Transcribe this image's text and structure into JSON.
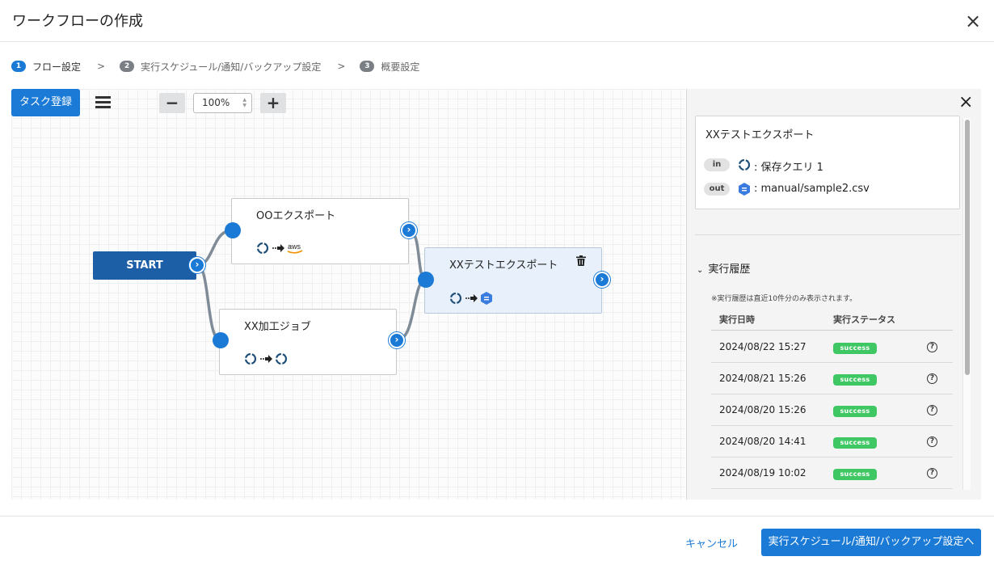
{
  "modal": {
    "title": "ワークフローの作成",
    "close_icon": "×"
  },
  "steps": [
    {
      "num": "1",
      "label": "フロー設定"
    },
    {
      "num": "2",
      "label": "実行スケジュール/通知/バックアップ設定"
    },
    {
      "num": "3",
      "label": "概要設定"
    }
  ],
  "step_separator": ">",
  "toolbar": {
    "task_button": "タスク登録",
    "zoom_minus": "−",
    "zoom_value": "100%",
    "zoom_plus": "+"
  },
  "flow": {
    "start_label": "START",
    "nodes": [
      {
        "label": "OOエクスポート"
      },
      {
        "label": "XX加工ジョブ"
      },
      {
        "label": "XXテストエクスポート"
      }
    ],
    "aws_label": "aws"
  },
  "panel": {
    "card_title": "XXテストエクスポート",
    "in_badge": "in",
    "in_value": ": 保存クエリ 1",
    "out_badge": "out",
    "out_value": ": manual/sample2.csv",
    "history_toggle": "実行履歴",
    "history_note": "※実行履歴は直近10件分のみ表示されます。",
    "col_date": "実行日時",
    "col_status": "実行ステータス",
    "rows": [
      {
        "date": "2024/08/22 15:27",
        "status": "success"
      },
      {
        "date": "2024/08/21 15:26",
        "status": "success"
      },
      {
        "date": "2024/08/20 15:26",
        "status": "success"
      },
      {
        "date": "2024/08/20 14:41",
        "status": "success"
      },
      {
        "date": "2024/08/19 10:02",
        "status": "success"
      }
    ],
    "help_glyph": "?"
  },
  "footer": {
    "cancel": "キャンセル",
    "next": "実行スケジュール/通知/バックアップ設定へ"
  },
  "colors": {
    "primary": "#1b7ad6",
    "start_node": "#1d5fa6",
    "success": "#3ec763",
    "selected_node_bg": "#e8f1fb"
  }
}
